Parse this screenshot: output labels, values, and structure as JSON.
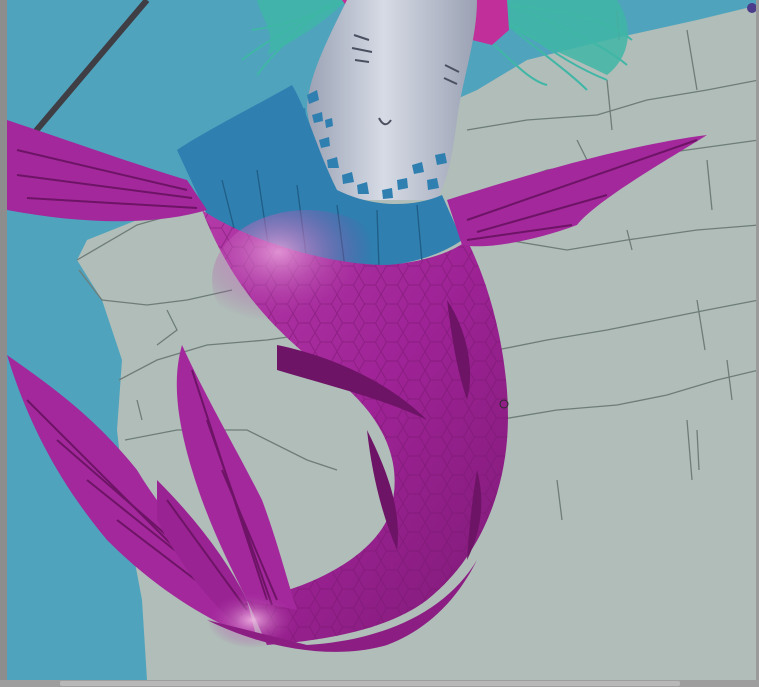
{
  "window": {
    "canvas_label": ""
  },
  "colors": {
    "sky": "#4fa3bd",
    "rock": "#b0bdb8",
    "rock_line": "#6f7d79",
    "tail_base": "#a3289c",
    "tail_dark": "#6e1466",
    "tail_light": "#d77ac9",
    "skirt": "#2f7fb0",
    "skin": "#b5bccb",
    "hair": "#3fb6a6",
    "accent_pink": "#c02f9a",
    "staff": "#3e3e44"
  },
  "icons": {
    "brush_cursor": "circle-cursor-icon"
  }
}
